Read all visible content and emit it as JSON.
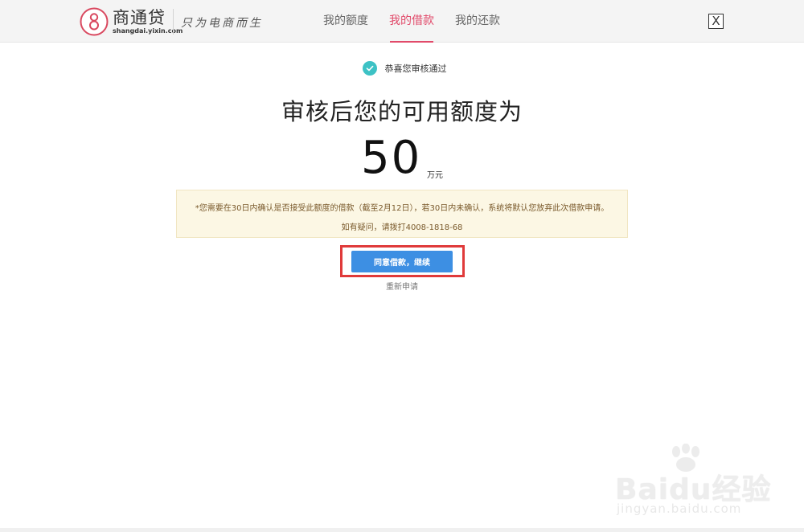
{
  "header": {
    "logo_name": "商通贷",
    "logo_domain": "shangdai.yixin.com",
    "slogan": "只为电商而生",
    "nav": [
      {
        "label": "我的额度",
        "active": false
      },
      {
        "label": "我的借款",
        "active": true
      },
      {
        "label": "我的还款",
        "active": false
      }
    ],
    "close_label": "X"
  },
  "main": {
    "success_text": "恭喜您审核通过",
    "headline": "审核后您的可用额度为",
    "amount": "50",
    "unit": "万元",
    "notice_line1": "*您需要在30日内确认是否接受此额度的借款（截至2月12日），若30日内未确认，系统将默认您放弃此次借款申请。",
    "notice_line2": "如有疑问，请拨打4008-1818-68",
    "agree_button": "同意借款，继续",
    "reapply_link": "重新申请"
  },
  "watermark": {
    "brand": "Baidu经验",
    "domain": "jingyan.baidu.com"
  },
  "colors": {
    "accent": "#e14a6a",
    "button": "#3d8fe3",
    "check": "#3dc2c5",
    "highlight": "#e03a3a",
    "notice_bg": "#fcf7e4"
  }
}
